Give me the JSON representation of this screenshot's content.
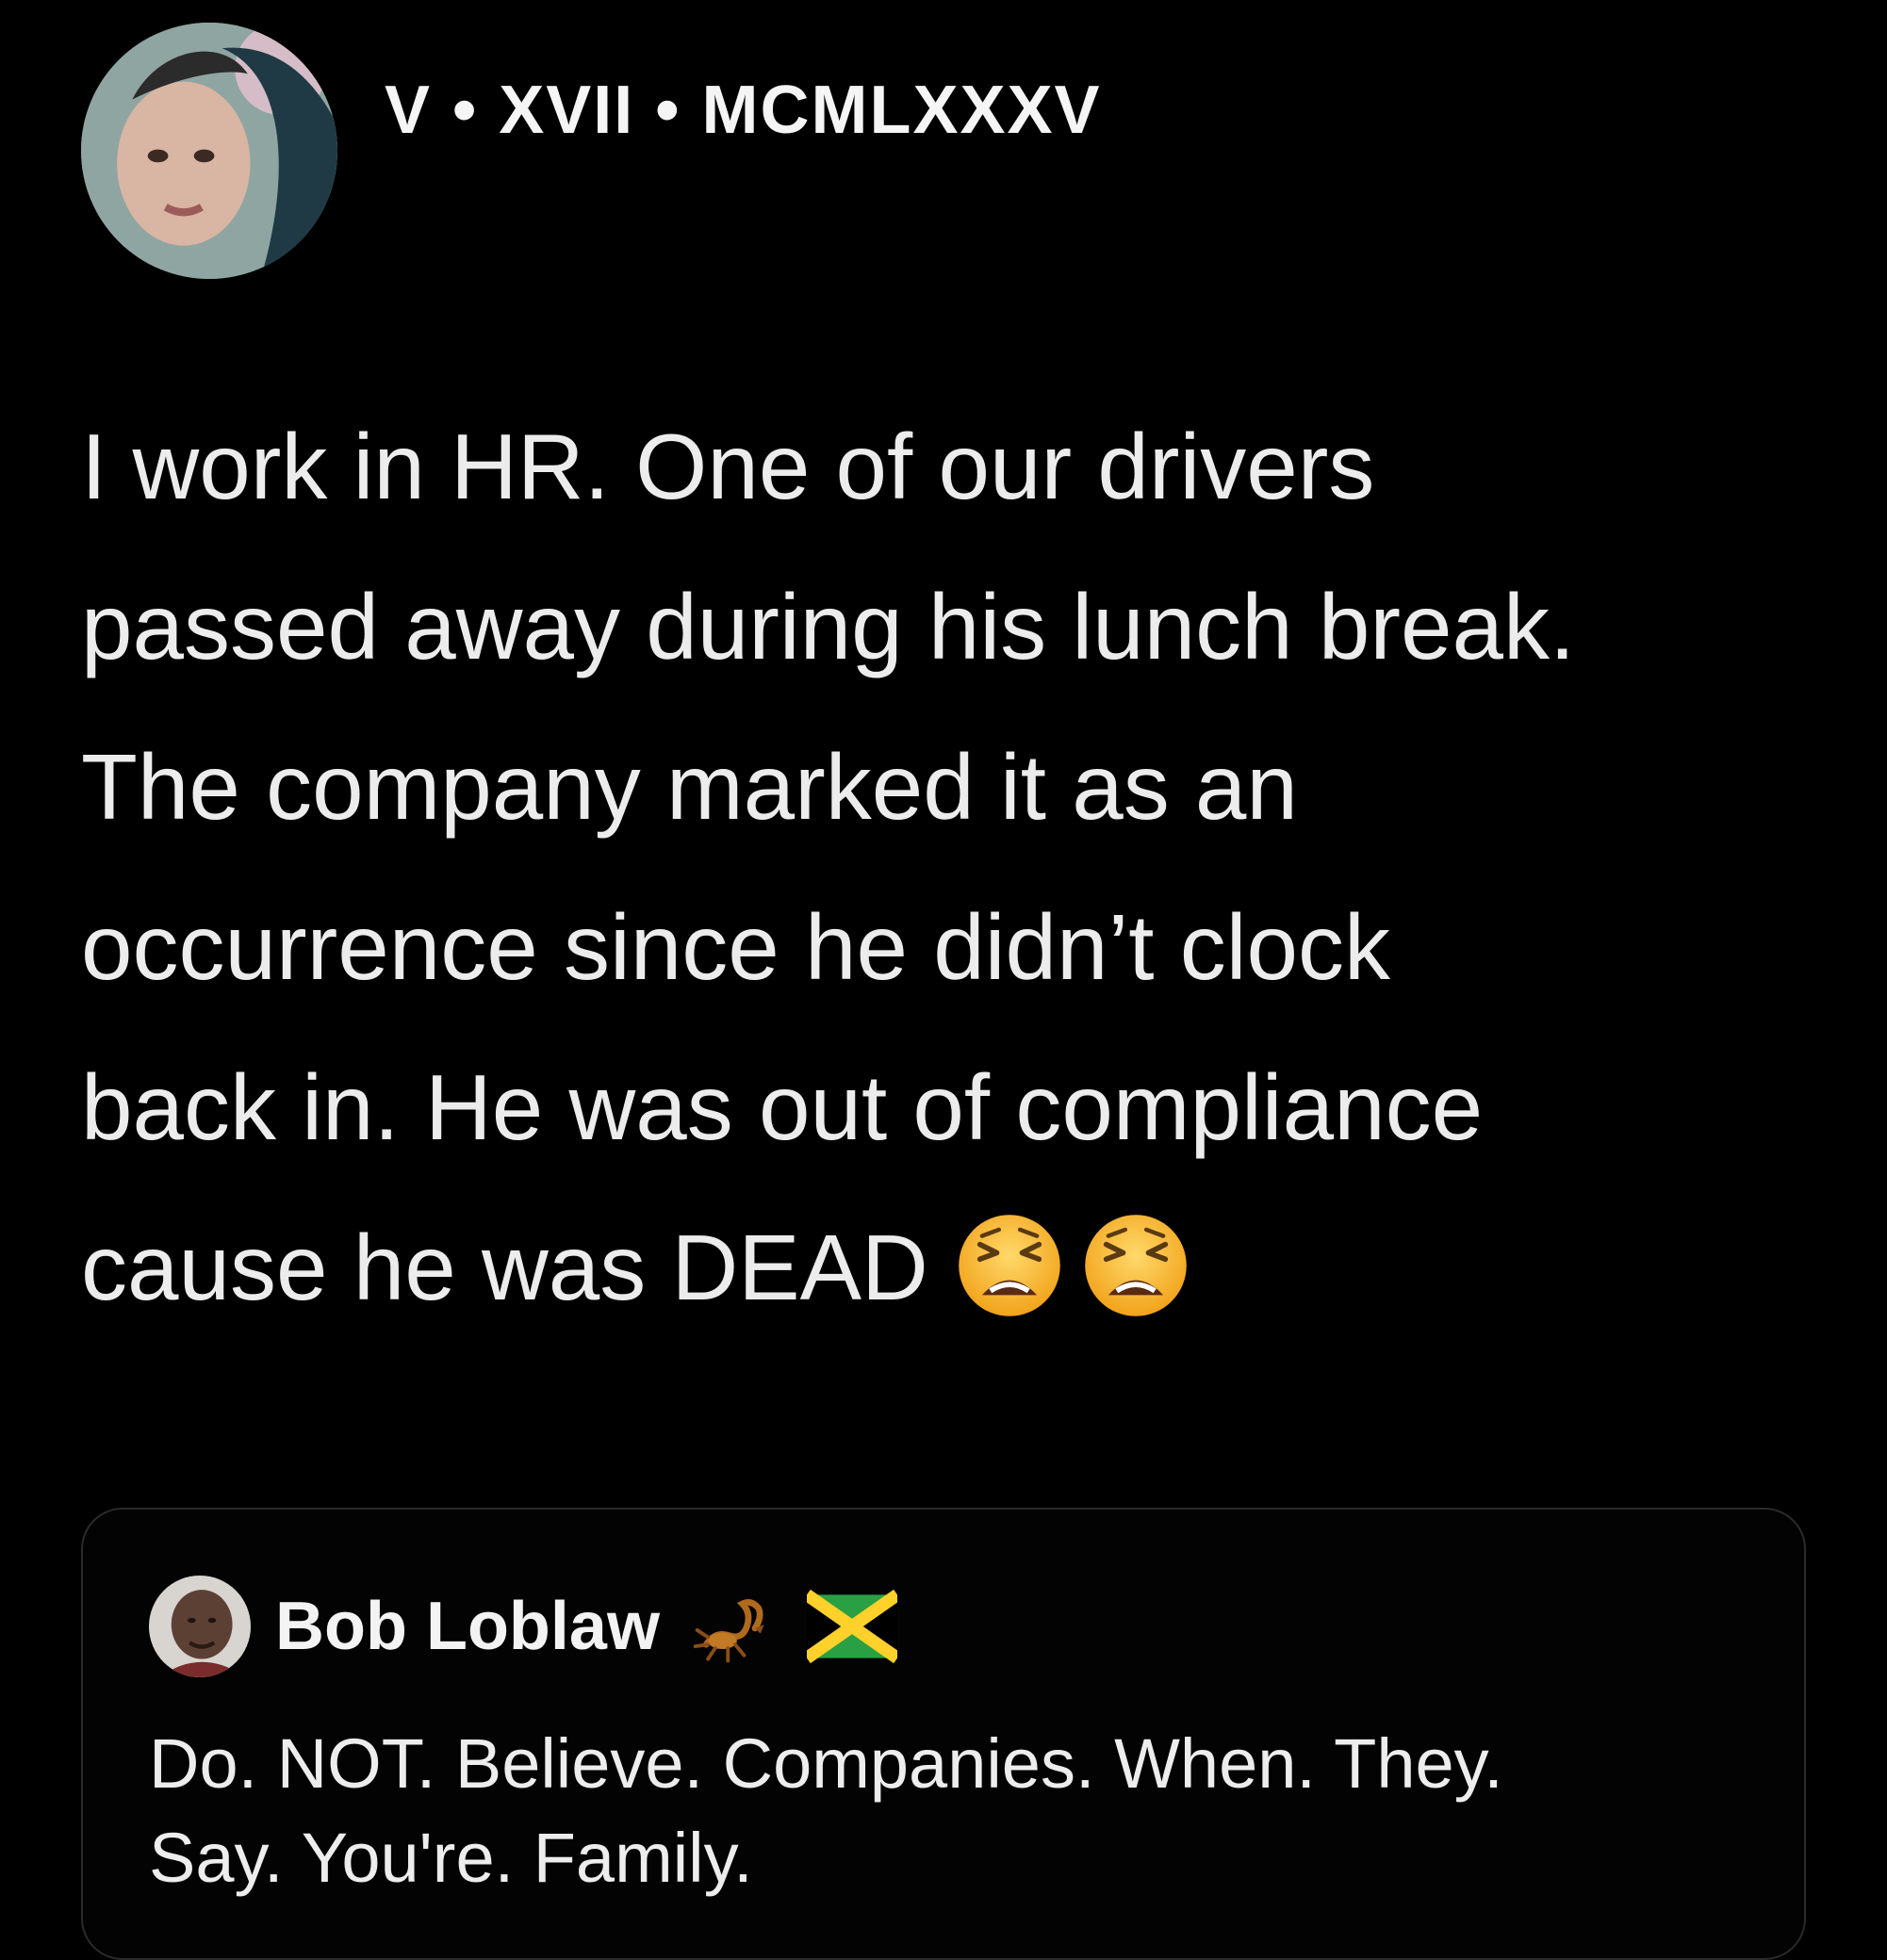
{
  "post": {
    "author": {
      "display_name": "V • XVII • MCMLXXXV",
      "avatar_icon": "profile-photo"
    },
    "body_lines": [
      "I work in HR. One of our drivers",
      "passed away during his lunch break.",
      "The company marked it as an",
      "occurrence since he didn’t clock",
      "back in. He was out of compliance",
      "cause he was DEAD"
    ],
    "trailing_emojis": [
      "weary-face-emoji",
      "weary-face-emoji"
    ]
  },
  "quoted_post": {
    "author": {
      "name": "Bob Loblaw",
      "avatar_icon": "profile-photo",
      "badges": [
        "scorpion-emoji",
        "jamaica-flag-emoji"
      ]
    },
    "text_lines": [
      "Do. NOT. Believe. Companies. When. They.",
      "Say. You're. Family."
    ]
  },
  "colors": {
    "background": "#000000",
    "text": "#ececec",
    "card_border": "#2a2a2a"
  }
}
